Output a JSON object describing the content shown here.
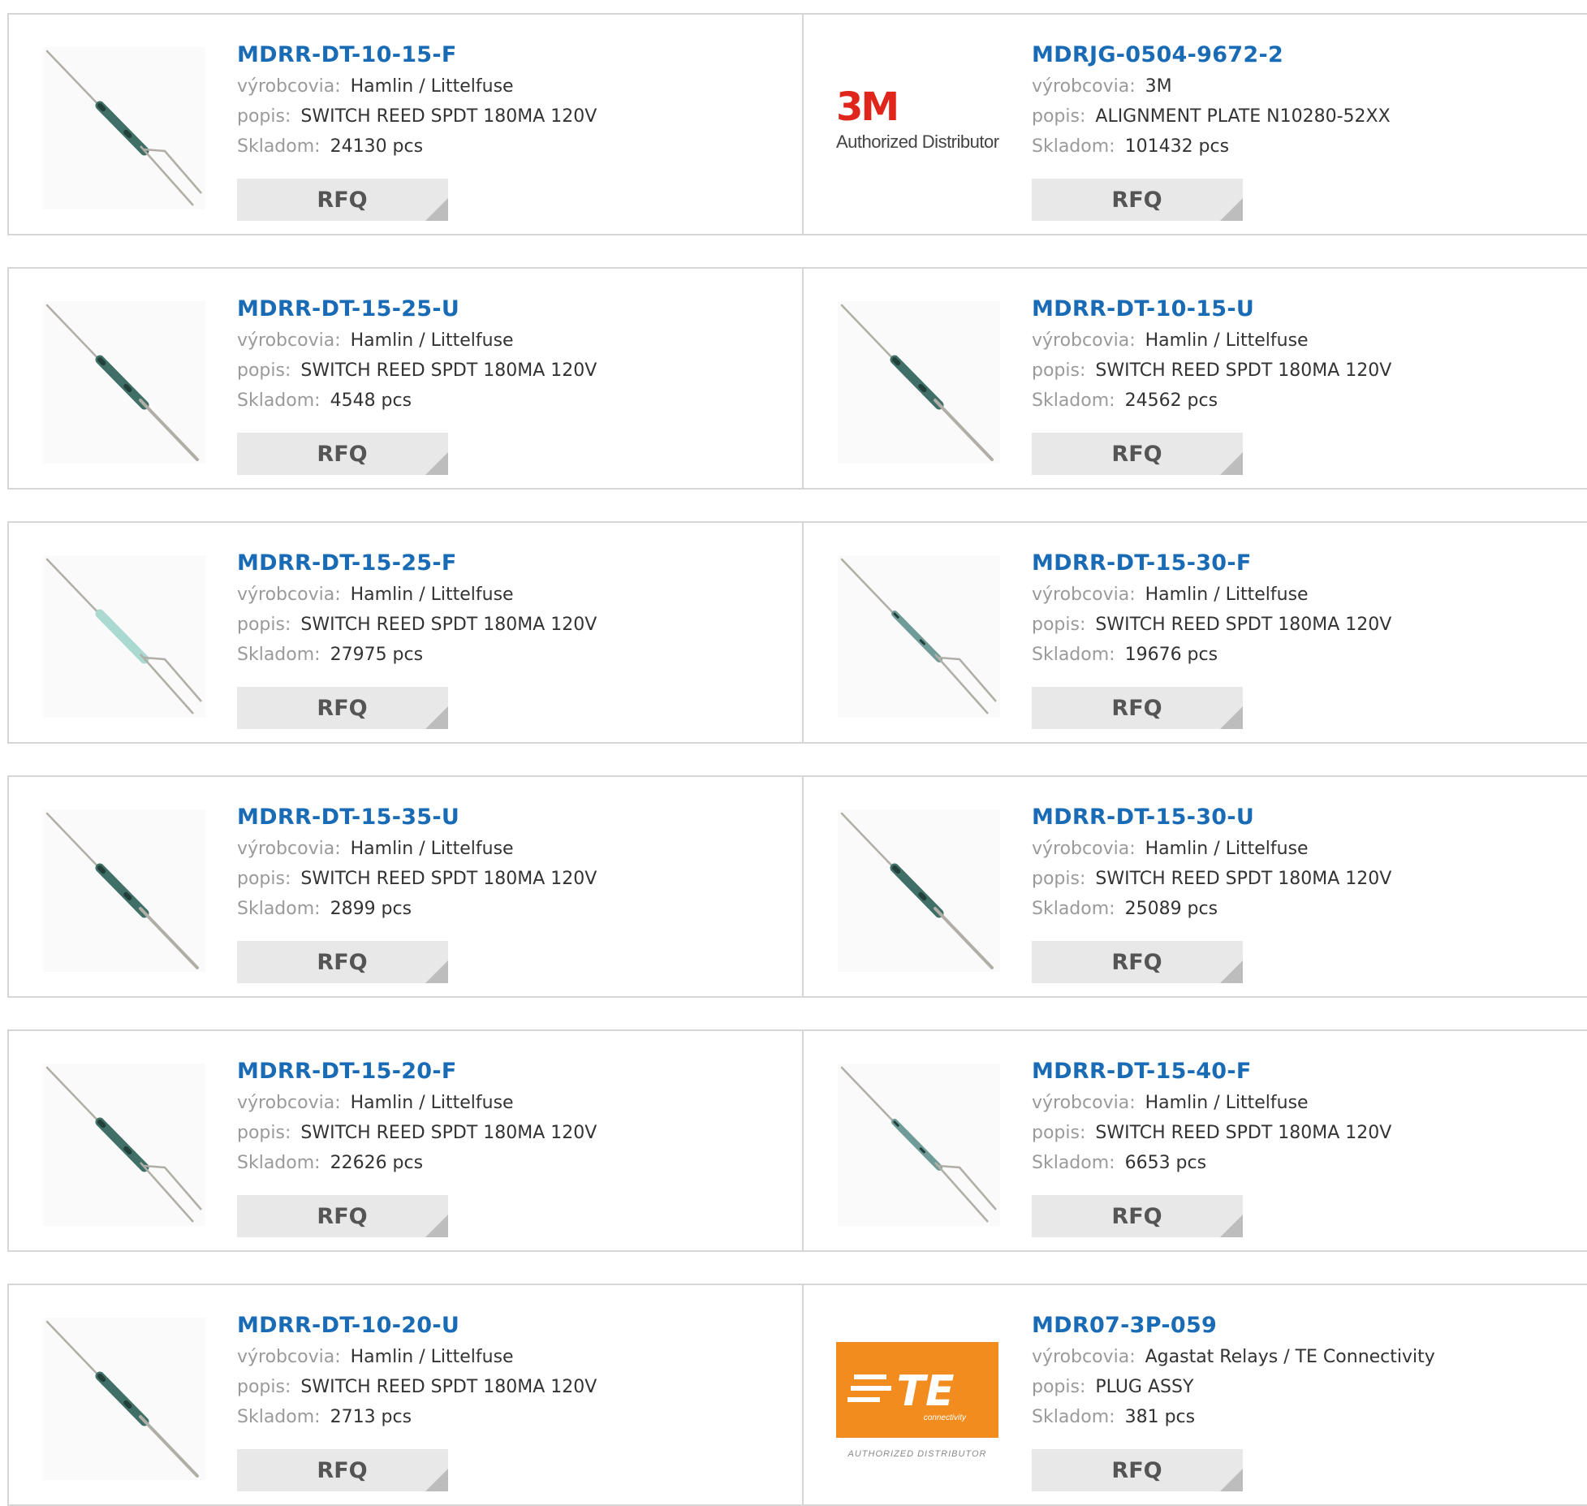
{
  "labels": {
    "manufacturer": "výrobcovia:",
    "description": "popis:",
    "stock": "Skladom:",
    "rfq": "RFQ"
  },
  "products": [
    {
      "pn": "MDRR-DT-10-15-F",
      "manufacturer": "Hamlin / Littelfuse",
      "description": "SWITCH REED SPDT 180MA 120V",
      "stock": "24130 pcs",
      "image": "reed-switch-fork"
    },
    {
      "pn": "MDRJG-0504-9672-2",
      "manufacturer": "3M",
      "description": "ALIGNMENT PLATE N10280-52XX",
      "stock": "101432 pcs",
      "image": "logo-3m"
    },
    {
      "pn": "MDRR-DT-15-25-U",
      "manufacturer": "Hamlin / Littelfuse",
      "description": "SWITCH REED SPDT 180MA 120V",
      "stock": "4548 pcs",
      "image": "reed-switch-straight"
    },
    {
      "pn": "MDRR-DT-10-15-U",
      "manufacturer": "Hamlin / Littelfuse",
      "description": "SWITCH REED SPDT 180MA 120V",
      "stock": "24562 pcs",
      "image": "reed-switch-straight"
    },
    {
      "pn": "MDRR-DT-15-25-F",
      "manufacturer": "Hamlin / Littelfuse",
      "description": "SWITCH REED SPDT 180MA 120V",
      "stock": "27975 pcs",
      "image": "reed-switch-fork-glass"
    },
    {
      "pn": "MDRR-DT-15-30-F",
      "manufacturer": "Hamlin / Littelfuse",
      "description": "SWITCH REED SPDT 180MA 120V",
      "stock": "19676 pcs",
      "image": "reed-switch-fork-thin"
    },
    {
      "pn": "MDRR-DT-15-35-U",
      "manufacturer": "Hamlin / Littelfuse",
      "description": "SWITCH REED SPDT 180MA 120V",
      "stock": "2899 pcs",
      "image": "reed-switch-straight"
    },
    {
      "pn": "MDRR-DT-15-30-U",
      "manufacturer": "Hamlin / Littelfuse",
      "description": "SWITCH REED SPDT 180MA 120V",
      "stock": "25089 pcs",
      "image": "reed-switch-straight"
    },
    {
      "pn": "MDRR-DT-15-20-F",
      "manufacturer": "Hamlin / Littelfuse",
      "description": "SWITCH REED SPDT 180MA 120V",
      "stock": "22626 pcs",
      "image": "reed-switch-fork"
    },
    {
      "pn": "MDRR-DT-15-40-F",
      "manufacturer": "Hamlin / Littelfuse",
      "description": "SWITCH REED SPDT 180MA 120V",
      "stock": "6653 pcs",
      "image": "reed-switch-fork-thin"
    },
    {
      "pn": "MDRR-DT-10-20-U",
      "manufacturer": "Hamlin / Littelfuse",
      "description": "SWITCH REED SPDT 180MA 120V",
      "stock": "2713 pcs",
      "image": "reed-switch-straight"
    },
    {
      "pn": "MDR07-3P-059",
      "manufacturer": "Agastat Relays / TE Connectivity",
      "description": "PLUG ASSY",
      "stock": "381 pcs",
      "image": "logo-te"
    }
  ],
  "logos": {
    "m3_mark": "3M",
    "m3_sub": "Authorized Distributor",
    "te_mark": "TE",
    "te_sub_small": "connectivity",
    "te_sub": "AUTHORIZED DISTRIBUTOR"
  },
  "colors": {
    "link": "#1a6bb5",
    "label": "#9a9a9a",
    "rfq_bg": "#e8e8e8",
    "brand_3m": "#e0251b",
    "brand_te": "#f28c1e"
  }
}
